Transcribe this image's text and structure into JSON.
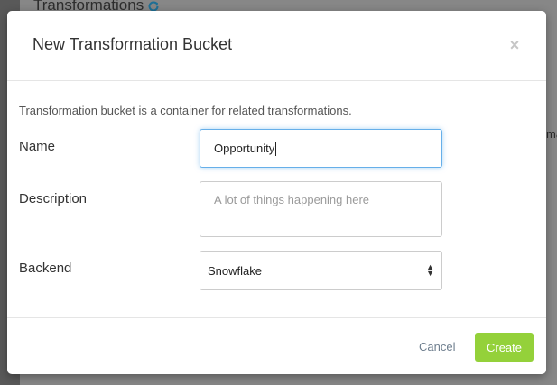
{
  "background": {
    "title": "Transformations",
    "side_text": "ma"
  },
  "modal": {
    "title": "New Transformation Bucket",
    "close_label": "×",
    "intro": "Transformation bucket is a container for related transformations.",
    "fields": {
      "name": {
        "label": "Name",
        "value": "Opportunity"
      },
      "description": {
        "label": "Description",
        "placeholder": "A lot of things happening here"
      },
      "backend": {
        "label": "Backend",
        "value": "Snowflake"
      }
    },
    "footer": {
      "cancel_label": "Cancel",
      "create_label": "Create"
    }
  },
  "colors": {
    "accent": "#94d13a",
    "focus": "#66afe9",
    "refresh_icon": "#2a9fd6"
  }
}
